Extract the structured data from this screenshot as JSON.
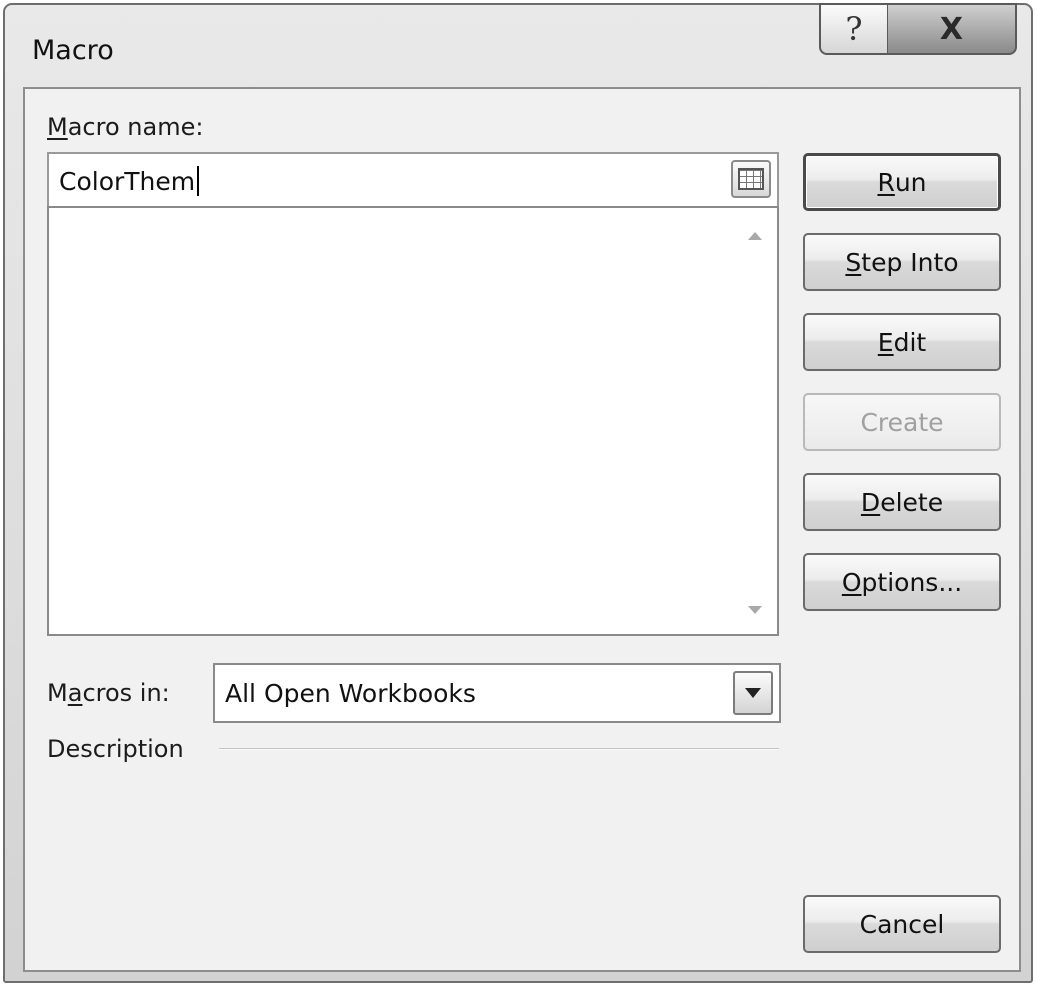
{
  "window": {
    "title": "Macro",
    "help_glyph": "?",
    "close_glyph": "X"
  },
  "macro_name": {
    "label_mnemonic": "M",
    "label_rest": "acro name:",
    "value": "ColorThem"
  },
  "macros_list": {
    "items": []
  },
  "macros_in": {
    "label_pre": "M",
    "label_mnemonic": "a",
    "label_rest": "cros in:",
    "value": "All Open Workbooks"
  },
  "description": {
    "label": "Description"
  },
  "buttons": {
    "run": {
      "mnemonic": "R",
      "rest": "un"
    },
    "step_into": {
      "mnemonic": "S",
      "rest": "tep Into"
    },
    "edit": {
      "mnemonic": "E",
      "rest": "dit"
    },
    "create": {
      "label": "Create",
      "disabled": true
    },
    "delete": {
      "mnemonic": "D",
      "rest": "elete"
    },
    "options": {
      "mnemonic": "O",
      "rest": "ptions..."
    },
    "cancel": {
      "label": "Cancel"
    }
  },
  "icons": {
    "refedit": "collapse-dialog-icon",
    "scroll_up": "scroll-up-arrow-icon",
    "scroll_down": "scroll-down-arrow-icon",
    "dropdown": "chevron-down-icon"
  }
}
